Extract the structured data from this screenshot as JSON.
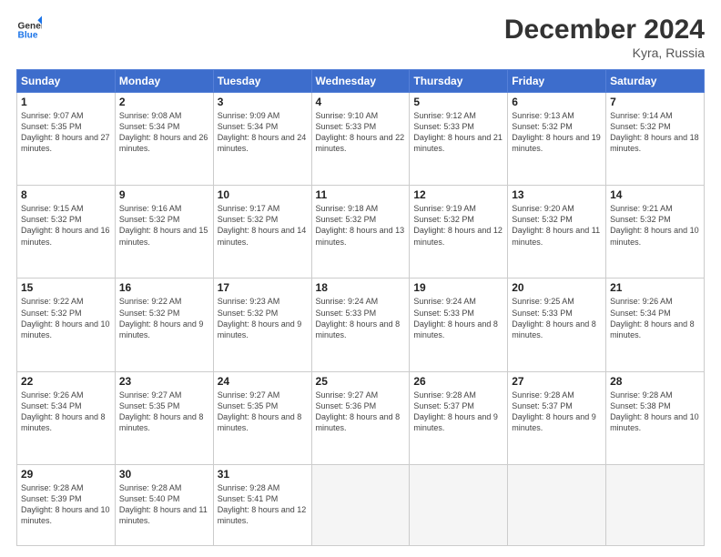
{
  "header": {
    "logo_line1": "General",
    "logo_line2": "Blue",
    "month": "December 2024",
    "location": "Kyra, Russia"
  },
  "columns": [
    "Sunday",
    "Monday",
    "Tuesday",
    "Wednesday",
    "Thursday",
    "Friday",
    "Saturday"
  ],
  "weeks": [
    [
      {
        "day": "1",
        "sunrise": "9:07 AM",
        "sunset": "5:35 PM",
        "daylight": "8 hours and 27 minutes."
      },
      {
        "day": "2",
        "sunrise": "9:08 AM",
        "sunset": "5:34 PM",
        "daylight": "8 hours and 26 minutes."
      },
      {
        "day": "3",
        "sunrise": "9:09 AM",
        "sunset": "5:34 PM",
        "daylight": "8 hours and 24 minutes."
      },
      {
        "day": "4",
        "sunrise": "9:10 AM",
        "sunset": "5:33 PM",
        "daylight": "8 hours and 22 minutes."
      },
      {
        "day": "5",
        "sunrise": "9:12 AM",
        "sunset": "5:33 PM",
        "daylight": "8 hours and 21 minutes."
      },
      {
        "day": "6",
        "sunrise": "9:13 AM",
        "sunset": "5:32 PM",
        "daylight": "8 hours and 19 minutes."
      },
      {
        "day": "7",
        "sunrise": "9:14 AM",
        "sunset": "5:32 PM",
        "daylight": "8 hours and 18 minutes."
      }
    ],
    [
      {
        "day": "8",
        "sunrise": "9:15 AM",
        "sunset": "5:32 PM",
        "daylight": "8 hours and 16 minutes."
      },
      {
        "day": "9",
        "sunrise": "9:16 AM",
        "sunset": "5:32 PM",
        "daylight": "8 hours and 15 minutes."
      },
      {
        "day": "10",
        "sunrise": "9:17 AM",
        "sunset": "5:32 PM",
        "daylight": "8 hours and 14 minutes."
      },
      {
        "day": "11",
        "sunrise": "9:18 AM",
        "sunset": "5:32 PM",
        "daylight": "8 hours and 13 minutes."
      },
      {
        "day": "12",
        "sunrise": "9:19 AM",
        "sunset": "5:32 PM",
        "daylight": "8 hours and 12 minutes."
      },
      {
        "day": "13",
        "sunrise": "9:20 AM",
        "sunset": "5:32 PM",
        "daylight": "8 hours and 11 minutes."
      },
      {
        "day": "14",
        "sunrise": "9:21 AM",
        "sunset": "5:32 PM",
        "daylight": "8 hours and 10 minutes."
      }
    ],
    [
      {
        "day": "15",
        "sunrise": "9:22 AM",
        "sunset": "5:32 PM",
        "daylight": "8 hours and 10 minutes."
      },
      {
        "day": "16",
        "sunrise": "9:22 AM",
        "sunset": "5:32 PM",
        "daylight": "8 hours and 9 minutes."
      },
      {
        "day": "17",
        "sunrise": "9:23 AM",
        "sunset": "5:32 PM",
        "daylight": "8 hours and 9 minutes."
      },
      {
        "day": "18",
        "sunrise": "9:24 AM",
        "sunset": "5:33 PM",
        "daylight": "8 hours and 8 minutes."
      },
      {
        "day": "19",
        "sunrise": "9:24 AM",
        "sunset": "5:33 PM",
        "daylight": "8 hours and 8 minutes."
      },
      {
        "day": "20",
        "sunrise": "9:25 AM",
        "sunset": "5:33 PM",
        "daylight": "8 hours and 8 minutes."
      },
      {
        "day": "21",
        "sunrise": "9:26 AM",
        "sunset": "5:34 PM",
        "daylight": "8 hours and 8 minutes."
      }
    ],
    [
      {
        "day": "22",
        "sunrise": "9:26 AM",
        "sunset": "5:34 PM",
        "daylight": "8 hours and 8 minutes."
      },
      {
        "day": "23",
        "sunrise": "9:27 AM",
        "sunset": "5:35 PM",
        "daylight": "8 hours and 8 minutes."
      },
      {
        "day": "24",
        "sunrise": "9:27 AM",
        "sunset": "5:35 PM",
        "daylight": "8 hours and 8 minutes."
      },
      {
        "day": "25",
        "sunrise": "9:27 AM",
        "sunset": "5:36 PM",
        "daylight": "8 hours and 8 minutes."
      },
      {
        "day": "26",
        "sunrise": "9:28 AM",
        "sunset": "5:37 PM",
        "daylight": "8 hours and 9 minutes."
      },
      {
        "day": "27",
        "sunrise": "9:28 AM",
        "sunset": "5:37 PM",
        "daylight": "8 hours and 9 minutes."
      },
      {
        "day": "28",
        "sunrise": "9:28 AM",
        "sunset": "5:38 PM",
        "daylight": "8 hours and 10 minutes."
      }
    ],
    [
      {
        "day": "29",
        "sunrise": "9:28 AM",
        "sunset": "5:39 PM",
        "daylight": "8 hours and 10 minutes."
      },
      {
        "day": "30",
        "sunrise": "9:28 AM",
        "sunset": "5:40 PM",
        "daylight": "8 hours and 11 minutes."
      },
      {
        "day": "31",
        "sunrise": "9:28 AM",
        "sunset": "5:41 PM",
        "daylight": "8 hours and 12 minutes."
      },
      null,
      null,
      null,
      null
    ]
  ]
}
